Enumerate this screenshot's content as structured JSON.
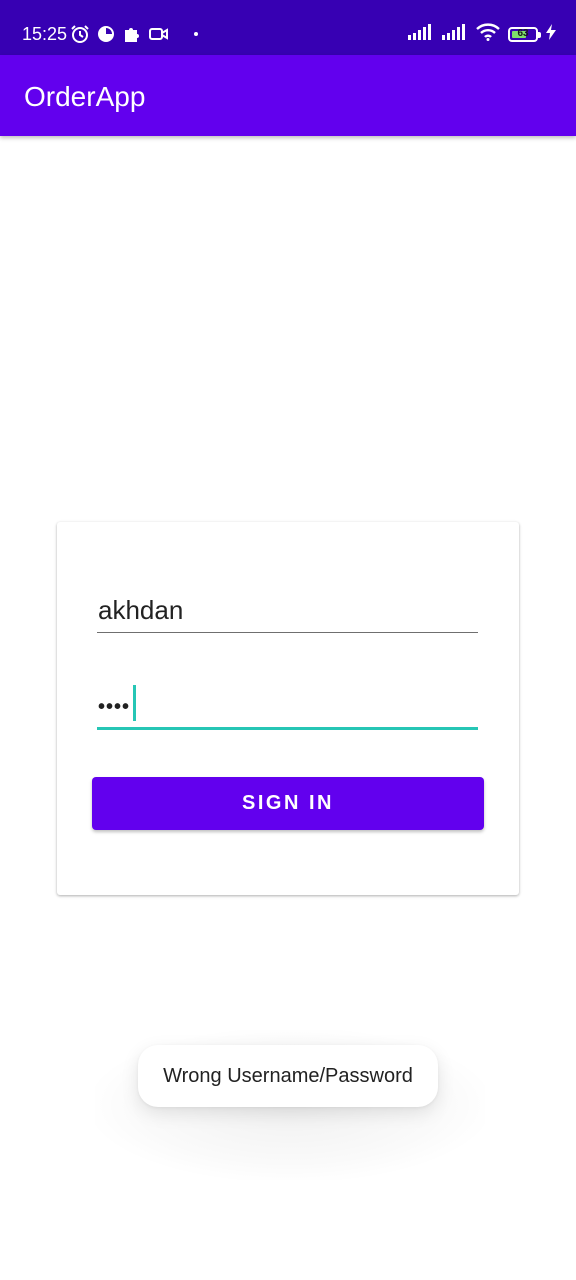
{
  "status_bar": {
    "time": "15:25",
    "left_icons": [
      "alarm-icon",
      "data-saver-icon",
      "puzzle-icon",
      "video-icon"
    ],
    "right_icons": [
      "signal-icon",
      "signal-icon",
      "wifi-icon",
      "battery-icon",
      "charging-icon"
    ],
    "battery_level": "63",
    "battery_fraction": 0.63
  },
  "app_bar": {
    "title": "OrderApp"
  },
  "login_form": {
    "username_value": "akhdan",
    "password_masked": "••••",
    "sign_in_label": "SIGN IN"
  },
  "toast": {
    "message": "Wrong Username/Password"
  },
  "colors": {
    "status_bar": "#3700b3",
    "primary": "#6200ee",
    "accent": "#26c6b5",
    "battery_fill": "#7ee06b"
  }
}
